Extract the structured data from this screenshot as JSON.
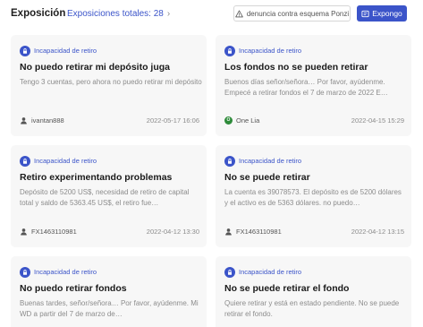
{
  "header": {
    "title": "Exposición",
    "total_link": "Exposiciones totales: 28",
    "denuncia_button": "denuncia contra esquema Ponzi",
    "expongo_button": "Expongo",
    "accent_color": "#3b54c9"
  },
  "cards": [
    {
      "badge": "Incapacidad de retiro",
      "title": "No puedo retirar mi depósito juga",
      "description": "Tengo 3 cuentas, pero ahora no puedo retirar mi depósito",
      "user": "ivantan888",
      "user_icon": "user-icon",
      "date": "2022-05-17 16:06"
    },
    {
      "badge": "Incapacidad de retiro",
      "title": "Los fondos no se pueden retirar",
      "description": "Buenos días señor/señora… Por favor, ayúdenme. Empecé a retirar fondos el 7 de marzo de 2022 E…",
      "user": "One Lia",
      "user_icon": "green-circle-icon",
      "date": "2022-04-15 15:29"
    },
    {
      "badge": "Incapacidad de retiro",
      "title": "Retiro experimentando problemas",
      "description": "Depósito de 5200 US$, necesidad de retiro de capital total y saldo de 5363.45 US$, el retiro fue…",
      "user": "FX1463110981",
      "user_icon": "user-icon",
      "date": "2022-04-12 13:30"
    },
    {
      "badge": "Incapacidad de retiro",
      "title": "No se puede retirar",
      "description": "La cuenta es 39078573. El depósito es de 5200 dólares y el activo es de 5363 dólares. no puedo…",
      "user": "FX1463110981",
      "user_icon": "user-icon",
      "date": "2022-04-12 13:15"
    },
    {
      "badge": "Incapacidad de retiro",
      "title": "No puedo retirar fondos",
      "description": "Buenas tardes, señor/señora… Por favor, ayúdenme. Mi WD a partir del 7 de marzo de…",
      "user": "",
      "user_icon": "",
      "date": ""
    },
    {
      "badge": "Incapacidad de retiro",
      "title": "No se puede retirar el fondo",
      "description": "Quiere retirar y está en estado pendiente. No se puede retirar el fondo.",
      "user": "",
      "user_icon": "",
      "date": ""
    }
  ]
}
